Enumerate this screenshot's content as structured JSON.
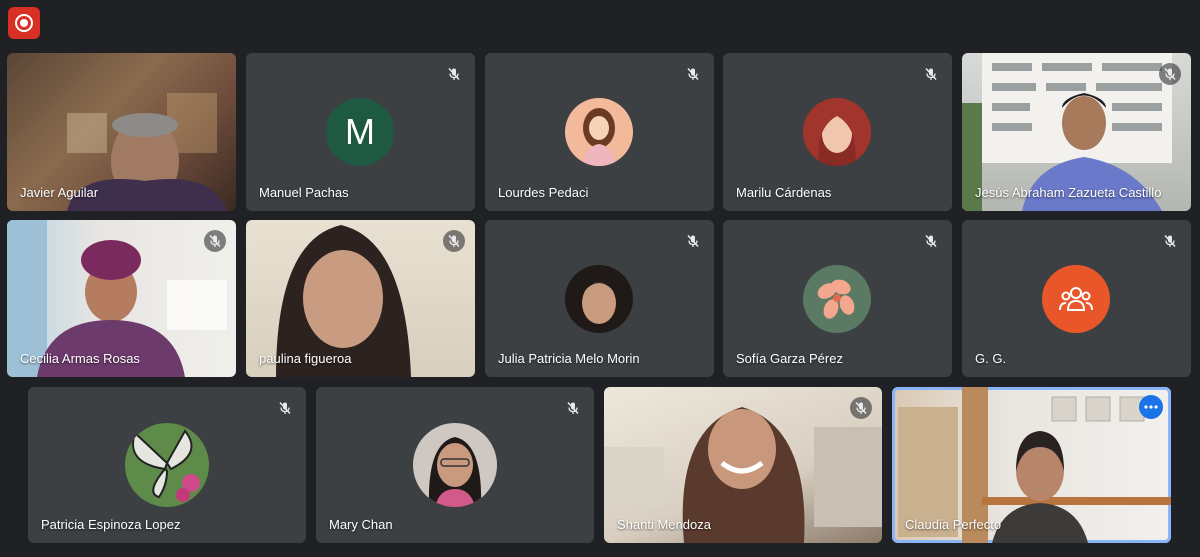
{
  "controls": {
    "record_icon": "record-icon"
  },
  "colors": {
    "background": "#202124",
    "tile": "#3c4043",
    "record": "#d93025",
    "selected_outline": "#8ab4f8",
    "avatar_m": "#1e5a42",
    "avatar_group": "#e8562a"
  },
  "participants": [
    {
      "name": "Javier Aguilar",
      "type": "video",
      "muted": false
    },
    {
      "name": "Manuel Pachas",
      "type": "avatar-letter",
      "letter": "M",
      "muted": true
    },
    {
      "name": "Lourdes Pedaci",
      "type": "avatar-photo",
      "muted": true
    },
    {
      "name": "Marilu Cárdenas",
      "type": "avatar-photo",
      "muted": true
    },
    {
      "name": "Jesús Abraham Zazueta Castillo",
      "type": "video",
      "muted": true
    },
    {
      "name": "Cecilia Armas Rosas",
      "type": "video",
      "muted": true
    },
    {
      "name": "paulina figueroa",
      "type": "video",
      "muted": true
    },
    {
      "name": "Julia Patricia Melo Morin",
      "type": "avatar-photo",
      "muted": true
    },
    {
      "name": "Sofía Garza Pérez",
      "type": "avatar-photo",
      "muted": true
    },
    {
      "name": "G. G.",
      "type": "avatar-icon",
      "icon": "group-icon",
      "muted": true
    },
    {
      "name": "Patricia Espinoza Lopez",
      "type": "avatar-photo",
      "muted": true
    },
    {
      "name": "Mary Chan",
      "type": "avatar-photo",
      "muted": true
    },
    {
      "name": "Shanti Mendoza",
      "type": "video",
      "muted": true
    },
    {
      "name": "Claudia Perfecto",
      "type": "video",
      "muted": false,
      "selected": true,
      "menu_icon": "more-options-icon"
    }
  ]
}
